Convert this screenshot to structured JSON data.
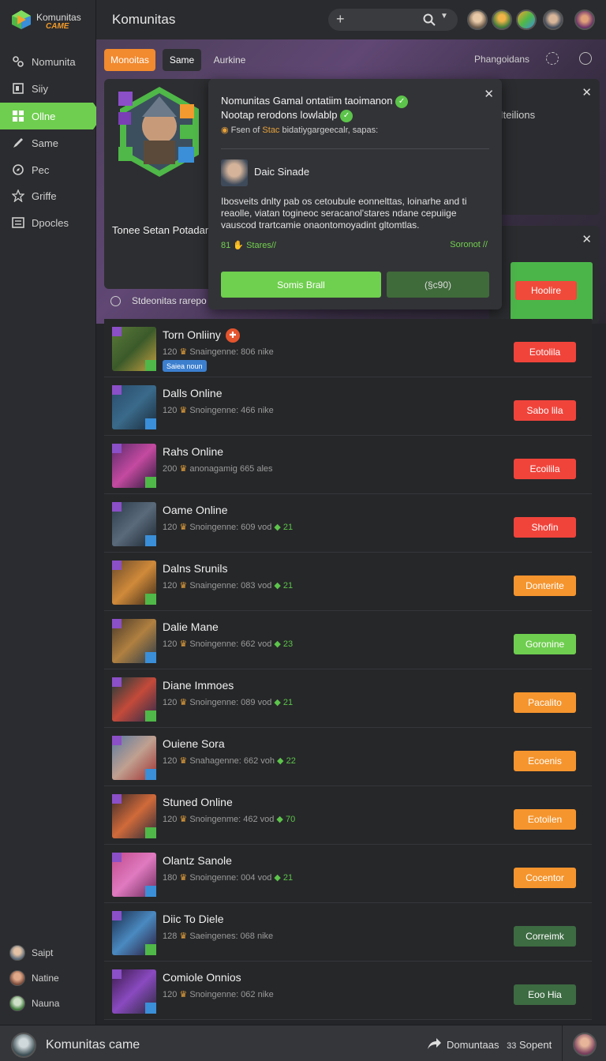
{
  "brand": {
    "name": "Komunitas",
    "tagline": "CAME"
  },
  "header": {
    "title": "Komunitas"
  },
  "sidebar": {
    "items": [
      {
        "label": "Nomunita",
        "icon": "community-icon"
      },
      {
        "label": "Siiy",
        "icon": "store-icon"
      },
      {
        "label": "Ollne",
        "icon": "grid-icon",
        "active": true
      },
      {
        "label": "Same",
        "icon": "pen-icon"
      },
      {
        "label": "Pec",
        "icon": "compass-icon"
      },
      {
        "label": "Griffe",
        "icon": "star-icon"
      },
      {
        "label": "Dpocles",
        "icon": "list-icon"
      }
    ],
    "users": [
      {
        "label": "Saipt"
      },
      {
        "label": "Natine"
      },
      {
        "label": "Nauna"
      }
    ]
  },
  "tabs": [
    {
      "label": "Monoitas"
    },
    {
      "label": "Same"
    },
    {
      "label": "Aurkine"
    }
  ],
  "hero": {
    "right_label": "Phangoidans"
  },
  "featured": {
    "name": "Tonee Setan Potadan"
  },
  "side_panel": {
    "text": "Iteilions",
    "button": "Hoolire"
  },
  "popup": {
    "title_1": "Nomunitas Gamal ontatiim taoimanon",
    "title_2": "Nootap rerodons lowlablp",
    "subtitle_prefix": "Fsen of",
    "subtitle_highlight": "Stac",
    "subtitle_rest": "bidatiygargeecalr, sapas:",
    "person_name": "Daic Sinade",
    "description": "Ibosveits dnlty pab os cetoubule eonnelttas, loinarhe and ti reaolle, viatan togineoc seracanol'stares ndane cepuiige vauscod trartcamie onaontomoyadint gltomtlas.",
    "stars_count": "81",
    "stars_label": "Stares//",
    "link_label": "Soronot //",
    "primary_button": "Somis Brall",
    "secondary_button": "(§c90)"
  },
  "filter": {
    "label": "Stdeonitas rarepo"
  },
  "rows": [
    {
      "title": "Torn Onliiny",
      "level": "120",
      "meta": "Snaingenne: 806 nike",
      "gem": "",
      "tag": "Saiea noun",
      "hot": true,
      "button": "Eotolila",
      "btn_color": "#f0443b"
    },
    {
      "title": "Dalls Online",
      "level": "120",
      "meta": "Snoingenne: 466 nike",
      "gem": "",
      "tag": "",
      "hot": false,
      "button": "Sabo lila",
      "btn_color": "#f0443b"
    },
    {
      "title": "Rahs Online",
      "level": "200",
      "meta": "anonagamig 665 ales",
      "gem": "",
      "tag": "",
      "hot": false,
      "button": "Ecoilila",
      "btn_color": "#f0443b"
    },
    {
      "title": "Oame Online",
      "level": "120",
      "meta": "Snoingenne: 609 vod",
      "gem": "21",
      "tag": "",
      "hot": false,
      "button": "Shofin",
      "btn_color": "#f0443b"
    },
    {
      "title": "Dalns Srunils",
      "level": "120",
      "meta": "Snaingenne: 083 vod",
      "gem": "21",
      "tag": "",
      "hot": false,
      "button": "Donterite",
      "btn_color": "#f5952e"
    },
    {
      "title": "Dalie Mane",
      "level": "120",
      "meta": "Snoingenne: 662 vod",
      "gem": "23",
      "tag": "",
      "hot": false,
      "button": "Goronine",
      "btn_color": "#6fce4f"
    },
    {
      "title": "Diane Immoes",
      "level": "120",
      "meta": "Snoingenne: 089 vod",
      "gem": "21",
      "tag": "",
      "hot": false,
      "button": "Pacalito",
      "btn_color": "#f5952e"
    },
    {
      "title": "Ouiene Sora",
      "level": "120",
      "meta": "Snahagenne: 662 voh",
      "gem": "22",
      "tag": "",
      "hot": false,
      "button": "Ecoenis",
      "btn_color": "#f5952e"
    },
    {
      "title": "Stuned Online",
      "level": "120",
      "meta": "Snoingenme: 462 vod",
      "gem": "70",
      "tag": "",
      "hot": false,
      "button": "Eotoilen",
      "btn_color": "#f5952e"
    },
    {
      "title": "Olantz Sanole",
      "level": "180",
      "meta": "Snoingenne: 004 vod",
      "gem": "21",
      "tag": "",
      "hot": false,
      "button": "Cocentor",
      "btn_color": "#f5952e"
    },
    {
      "title": "Diic To Diele",
      "level": "128",
      "meta": "Saeingenes: 068 nike",
      "gem": "",
      "tag": "",
      "hot": false,
      "button": "Correimk",
      "btn_color": "#3d6b42"
    },
    {
      "title": "Comiole Onnios",
      "level": "120",
      "meta": "Snoingenne: 062 nike",
      "gem": "",
      "tag": "",
      "hot": false,
      "button": "Eoo Hia",
      "btn_color": "#3d6b42"
    }
  ],
  "bottom": {
    "title": "Komunitas came",
    "right_label": "Domuntaas",
    "right_count": "33",
    "right_suffix": "Sopent"
  }
}
